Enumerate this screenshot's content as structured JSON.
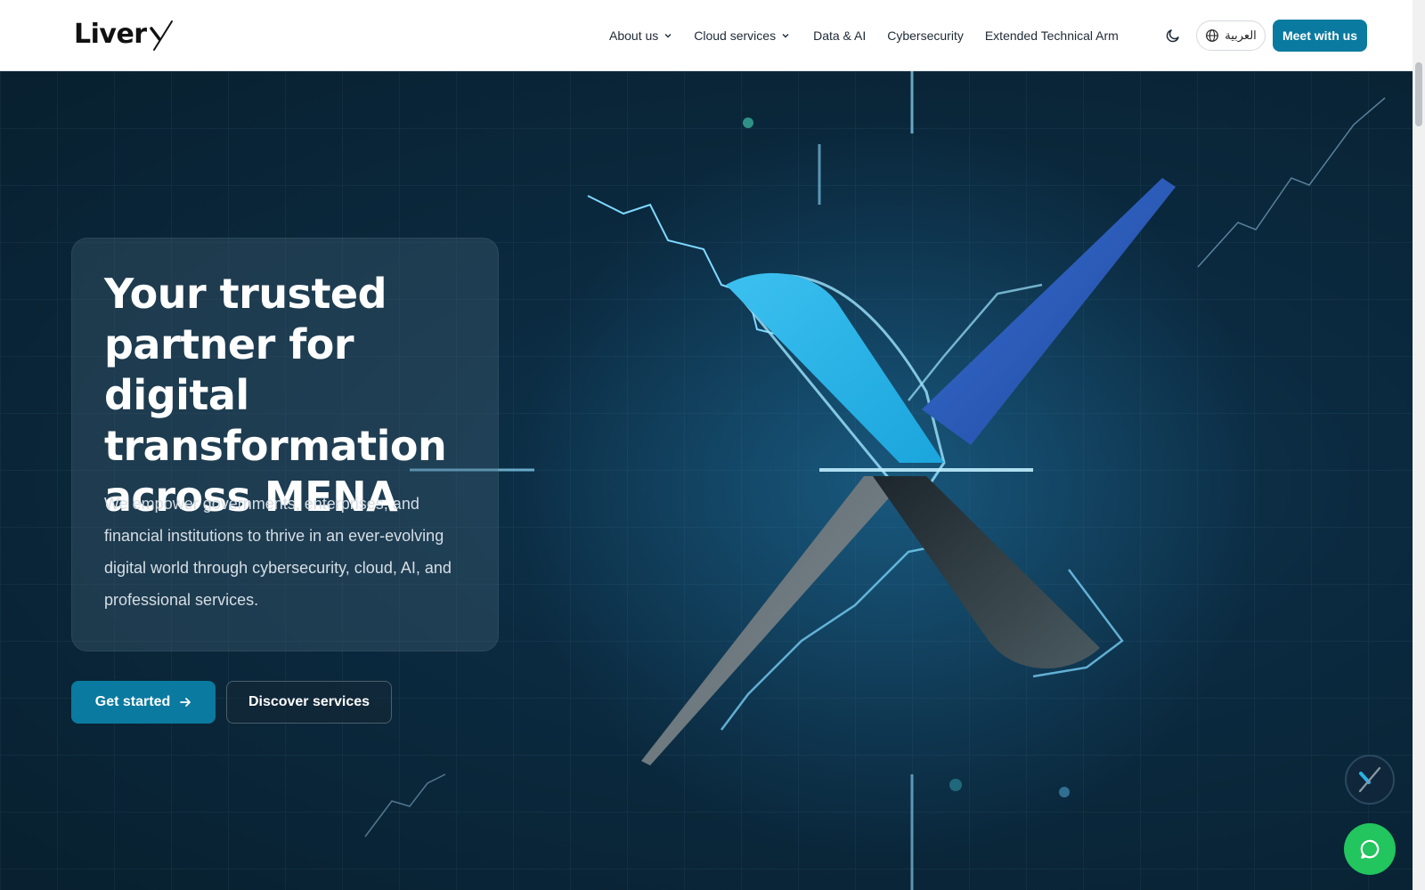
{
  "header": {
    "logo_text": "Liver",
    "nav": [
      {
        "label": "About us",
        "has_dropdown": true
      },
      {
        "label": "Cloud services",
        "has_dropdown": true
      },
      {
        "label": "Data & AI",
        "has_dropdown": false
      },
      {
        "label": "Cybersecurity",
        "has_dropdown": false
      },
      {
        "label": "Extended Technical Arm",
        "has_dropdown": false
      }
    ],
    "theme_icon": "moon-icon",
    "language_label": "العربية",
    "language_icon": "globe-icon",
    "cta_label": "Meet with us"
  },
  "hero": {
    "title": "Your trusted partner for digital transformation across MENA",
    "subtitle": "We empower governments, enterprises, and financial institutions to thrive in an ever-evolving digital world through cybersecurity, cloud, AI, and professional services.",
    "primary_button": "Get started",
    "primary_button_icon": "arrow-right-icon",
    "secondary_button": "Discover services"
  },
  "widgets": {
    "floating_logo_icon": "liverx-logo-icon",
    "chat_icon": "chat-bubble-icon"
  },
  "colors": {
    "accent": "#0a7aa0",
    "hero_bg": "#0b2a40",
    "chat": "#22c55e",
    "x_light_blue": "#29b6e8",
    "x_dark_blue": "#2458b8"
  }
}
